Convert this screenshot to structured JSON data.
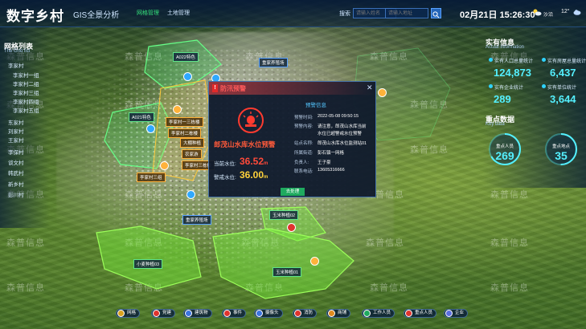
{
  "header": {
    "title": "数字乡村",
    "subtitle": "GIS全景分析",
    "tabs": [
      {
        "label": "网格管理",
        "active": true
      },
      {
        "label": "土地管理",
        "active": false
      }
    ],
    "search_label": "搜索",
    "search_placeholder_1": "请输入姓名",
    "search_placeholder_2": "请输入地址",
    "date_time": "02月21日 15:26:30",
    "weather": "沙沿",
    "temperature": "12°"
  },
  "left_panel": {
    "title": "网格列表",
    "subtitle": "The Grid list",
    "items": [
      "李家村",
      "李家村一组",
      "李家村二组",
      "李家村三组",
      "李家村四组",
      "李家村五组",
      "东家村",
      "刘家村",
      "王家村",
      "李保村",
      "谈文村",
      "韩武村",
      "新乡村",
      "彭川村"
    ]
  },
  "right_panel": {
    "title": "实有信息",
    "subtitle": "Actual information",
    "stats": [
      {
        "label": "实有人口总量统计",
        "value": "124,873"
      },
      {
        "label": "实有房屋总量统计",
        "value": "6,437"
      },
      {
        "label": "实有企业统计",
        "value": "289"
      },
      {
        "label": "实有单位统计",
        "value": "3,644"
      }
    ],
    "key_title": "重点数据",
    "key_subtitle": "Key data",
    "key_data": [
      {
        "label": "重点人员",
        "value": "269"
      },
      {
        "label": "重点地点",
        "value": "35"
      }
    ]
  },
  "map_tags": [
    {
      "text": "A022特色"
    },
    {
      "text": "重家养殖场"
    },
    {
      "text": "A021特色"
    },
    {
      "text": "李家村一三栋楼"
    },
    {
      "text": "李家村二栋楼"
    },
    {
      "text": "大棚种植"
    },
    {
      "text": "农家游"
    },
    {
      "text": "李家村三组"
    },
    {
      "text": "李家村三栋楼"
    },
    {
      "text": "重家养殖场"
    },
    {
      "text": "小麦种植03"
    },
    {
      "text": "玉米种植02"
    },
    {
      "text": "玉米种植01"
    }
  ],
  "alert": {
    "title": "防汛预警",
    "name": "郎茂山水库水位预警",
    "current_level_label": "当前水位:",
    "current_level_value": "36.52",
    "current_level_unit": "m",
    "warning_level_label": "警戒水位:",
    "warning_level_value": "36.00",
    "warning_level_unit": "m",
    "info_title": "预警信息",
    "info": [
      {
        "key": "预警时间:",
        "value": "2022-05-08  09:50:15"
      },
      {
        "key": "预警内容:",
        "value": "请注意，郎茂山水库当前"
      },
      {
        "key": "",
        "value": "水位已超警戒水位预警"
      },
      {
        "key": "站点名称:",
        "value": "郎茂山水库水位监测站01"
      },
      {
        "key": "所属街道:",
        "value": "彭石镇一网格"
      },
      {
        "key": "负责人:",
        "value": "王子豪"
      },
      {
        "key": "联系电话:",
        "value": "13605316666"
      }
    ],
    "button_label": "去处理"
  },
  "toolbar": [
    {
      "label": "网格",
      "color": "#d9a21f"
    },
    {
      "label": "党建",
      "color": "#e0342e"
    },
    {
      "label": "建筑物",
      "color": "#3b74e0"
    },
    {
      "label": "事件",
      "color": "#e0342e"
    },
    {
      "label": "摄像头",
      "color": "#3b74e0"
    },
    {
      "label": "消防",
      "color": "#e0342e"
    },
    {
      "label": "商铺",
      "color": "#e08a1f"
    },
    {
      "label": "工作人员",
      "color": "#1faa5f"
    },
    {
      "label": "重点人员",
      "color": "#e0342e"
    },
    {
      "label": "企业",
      "color": "#5a6ee0"
    }
  ],
  "watermark": "森普信息"
}
